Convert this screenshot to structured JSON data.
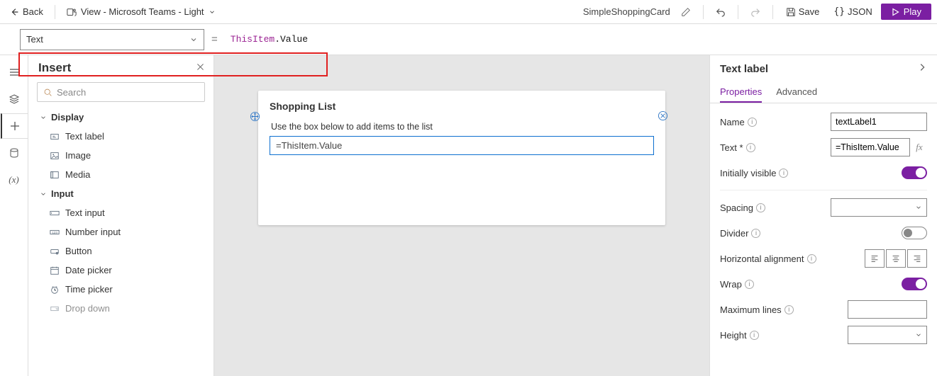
{
  "topbar": {
    "back_label": "Back",
    "view_label": "View - Microsoft Teams - Light",
    "app_name": "SimpleShoppingCard",
    "save_label": "Save",
    "json_label": "JSON",
    "play_label": "Play"
  },
  "formula_bar": {
    "property": "Text",
    "formula_obj": "ThisItem",
    "formula_prop": ".Value"
  },
  "insert": {
    "title": "Insert",
    "search_placeholder": "Search",
    "cat_display": "Display",
    "item_text_label": "Text label",
    "item_image": "Image",
    "item_media": "Media",
    "cat_input": "Input",
    "item_text_input": "Text input",
    "item_number_input": "Number input",
    "item_button": "Button",
    "item_date_picker": "Date picker",
    "item_time_picker": "Time picker",
    "item_dropdown": "Drop down"
  },
  "canvas": {
    "card_title": "Shopping List",
    "card_subtitle": "Use the box below to add items to the list",
    "card_input_value": "=ThisItem.Value"
  },
  "props": {
    "header": "Text label",
    "tab_properties": "Properties",
    "tab_advanced": "Advanced",
    "name_label": "Name",
    "name_value": "textLabel1",
    "text_label": "Text *",
    "text_value": "=ThisItem.Value",
    "visible_label": "Initially visible",
    "spacing_label": "Spacing",
    "divider_label": "Divider",
    "halign_label": "Horizontal alignment",
    "wrap_label": "Wrap",
    "maxlines_label": "Maximum lines",
    "height_label": "Height"
  }
}
